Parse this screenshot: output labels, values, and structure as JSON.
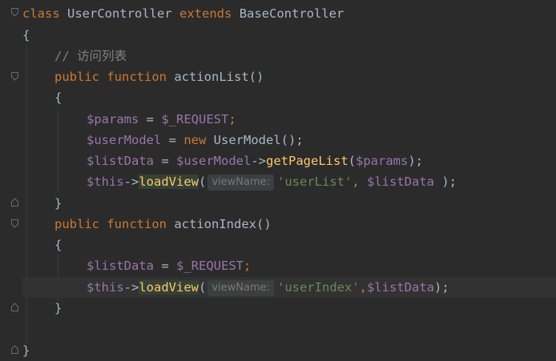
{
  "code": {
    "line1": {
      "kw1": "class",
      "name": "UserController",
      "kw2": "extends",
      "base": "BaseController"
    },
    "brace_open": "{",
    "comment": "// 访问列表",
    "m1": {
      "kw1": "public",
      "kw2": "function",
      "name": "actionList",
      "paren": "()"
    },
    "m1_open": "{",
    "s1": {
      "var": "$params",
      "eq": " = ",
      "rhs": "$_REQUEST",
      "end": ";"
    },
    "s2": {
      "var": "$userModel",
      "eq": " = ",
      "kw": "new",
      "cls": " UserModel",
      "end": "();"
    },
    "s3": {
      "var": "$listData",
      "eq": " = ",
      "obj": "$userModel",
      "arrow": "->",
      "fn": "getPageList",
      "open": "(",
      "arg": "$params",
      "end": ");"
    },
    "s4": {
      "this": "$this",
      "arrow": "->",
      "fn": "loadView",
      "open": "(",
      "hint": "viewName:",
      "str": "'userList'",
      "comma": ", ",
      "arg": "$listData",
      "end": " );"
    },
    "m1_close": "}",
    "m2": {
      "kw1": "public",
      "kw2": "function",
      "name": "actionIndex",
      "paren": "()"
    },
    "m2_open": "{",
    "t1": {
      "var": "$listData",
      "eq": " = ",
      "rhs": "$_REQUEST",
      "end": ";"
    },
    "t2": {
      "this": "$this",
      "arrow": "->",
      "fn": "loadView",
      "open": "(",
      "hint": "viewName:",
      "str": "'userIndex'",
      "comma": ",",
      "arg": "$listData",
      "end": ");"
    },
    "m2_close": "}",
    "brace_close": "}"
  },
  "colors": {
    "background": "#2b2b2b",
    "keyword": "#cc7832",
    "function": "#ffc66d",
    "variable": "#9876aa",
    "string": "#6a8759",
    "comment": "#808080",
    "text": "#a9b7c6"
  }
}
